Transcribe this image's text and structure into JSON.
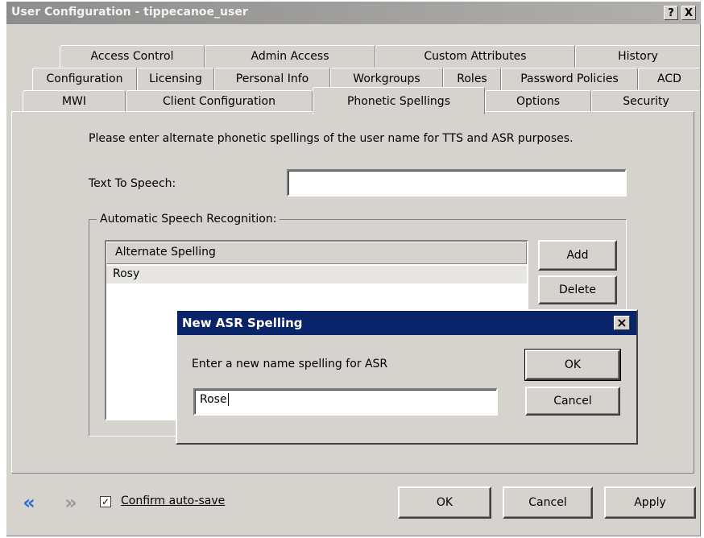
{
  "window": {
    "title": "User Configuration - tippecanoe_user"
  },
  "titlebar_buttons": {
    "help": "?",
    "close": "X"
  },
  "tabs": {
    "row1": [
      "Access Control",
      "Admin Access",
      "Custom Attributes",
      "History"
    ],
    "row2": [
      "Configuration",
      "Licensing",
      "Personal Info",
      "Workgroups",
      "Roles",
      "Password Policies",
      "ACD"
    ],
    "row3": [
      "MWI",
      "Client Configuration",
      "Phonetic Spellings",
      "Options",
      "Security"
    ],
    "active": "Phonetic Spellings"
  },
  "panel": {
    "instructions": "Please enter alternate phonetic spellings of the user name for TTS and ASR purposes.",
    "tts_label": "Text To Speech:",
    "tts_value": "",
    "asr_group_label": "Automatic Speech Recognition:",
    "list_header": "Alternate Spelling",
    "list_items": [
      "Rosy"
    ],
    "add_button": "Add",
    "delete_button": "Delete"
  },
  "dialog": {
    "title": "New ASR Spelling",
    "prompt": "Enter a new name spelling for ASR",
    "input_value": "Rose",
    "ok_button": "OK",
    "cancel_button": "Cancel",
    "close_glyph": "×"
  },
  "bottom": {
    "nav_back_glyph": "«",
    "nav_forward_glyph": "»",
    "confirm_autosave_label": "Confirm auto-save",
    "confirm_autosave_checked": true,
    "check_glyph": "✓",
    "ok_button": "OK",
    "cancel_button": "Cancel",
    "apply_button": "Apply"
  },
  "colors": {
    "dialog_title_bg": "#0a246a",
    "window_bg": "#d6d3ce",
    "nav_back_color": "#2a6ed8",
    "nav_forward_color": "#9a9a9a"
  }
}
